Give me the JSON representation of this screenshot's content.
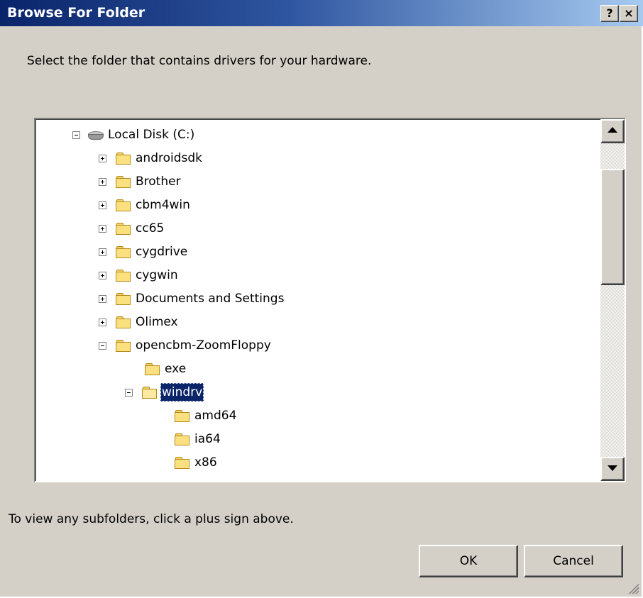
{
  "window": {
    "title": "Browse For Folder",
    "help_button": "?",
    "close_button": "×"
  },
  "instruction": "Select the folder that contains drivers for your hardware.",
  "tree": {
    "nodes": [
      {
        "label": "Local Disk (C:)",
        "icon": "hard-disk-icon",
        "expander": "minus"
      },
      {
        "label": "androidsdk",
        "icon": "folder-icon",
        "expander": "plus"
      },
      {
        "label": "Brother",
        "icon": "folder-icon",
        "expander": "plus"
      },
      {
        "label": "cbm4win",
        "icon": "folder-icon",
        "expander": "plus"
      },
      {
        "label": "cc65",
        "icon": "folder-icon",
        "expander": "plus"
      },
      {
        "label": "cygdrive",
        "icon": "folder-icon",
        "expander": "plus"
      },
      {
        "label": "cygwin",
        "icon": "folder-icon",
        "expander": "plus"
      },
      {
        "label": "Documents and Settings",
        "icon": "folder-icon",
        "expander": "plus"
      },
      {
        "label": "Olimex",
        "icon": "folder-icon",
        "expander": "plus"
      },
      {
        "label": "opencbm-ZoomFloppy",
        "icon": "folder-icon",
        "expander": "minus"
      },
      {
        "label": "exe",
        "icon": "folder-icon",
        "expander": "none"
      },
      {
        "label": "windrv",
        "icon": "open-folder-icon",
        "expander": "minus",
        "selected": true
      },
      {
        "label": "amd64",
        "icon": "folder-icon",
        "expander": "none"
      },
      {
        "label": "ia64",
        "icon": "folder-icon",
        "expander": "none"
      },
      {
        "label": "x86",
        "icon": "folder-icon",
        "expander": "none"
      }
    ]
  },
  "hint": "To view any subfolders, click a plus sign above.",
  "buttons": {
    "ok": "OK",
    "cancel": "Cancel"
  },
  "colors": {
    "title_gradient_start": "#0a246a",
    "title_gradient_end": "#a6caf0",
    "selection": "#0a246a",
    "dialog_face": "#d4d0c8"
  }
}
